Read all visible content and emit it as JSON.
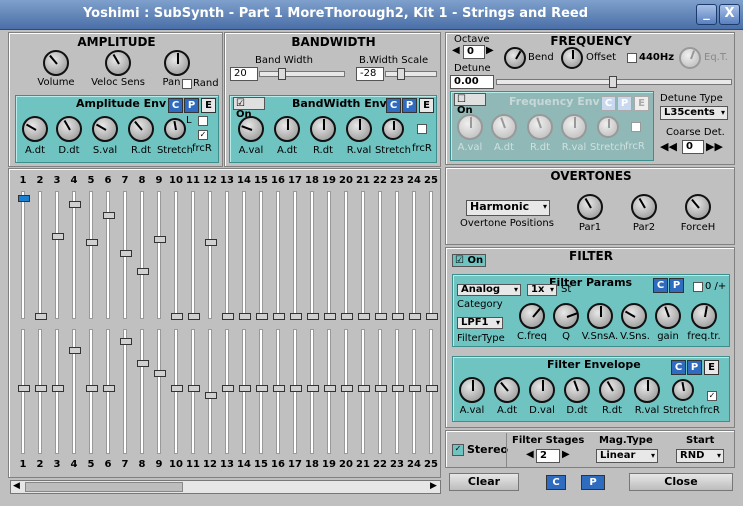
{
  "window": {
    "title": "Yoshimi : SubSynth - Part 1 MoreThorough2, Kit 1 - Strings and Reed",
    "minimize": "_",
    "close": "X"
  },
  "amplitude": {
    "title": "AMPLITUDE",
    "volume": "Volume",
    "velsens": "Veloc Sens",
    "pan": "Pan",
    "rand": "Rand",
    "env": {
      "title": "Amplitude Env",
      "c": "C",
      "p": "P",
      "e": "E",
      "l": "L",
      "knobs": [
        "A.dt",
        "D.dt",
        "S.val",
        "R.dt",
        "Stretch"
      ],
      "frcr": "frcR"
    }
  },
  "bandwidth": {
    "title": "BANDWIDTH",
    "bw": "Band Width",
    "bw_value": "20",
    "bwscale": "B.Width Scale",
    "bwscale_value": "-28",
    "env": {
      "on": "On",
      "title": "BandWidth Env",
      "c": "C",
      "p": "P",
      "e": "E",
      "knobs": [
        "A.val",
        "A.dt",
        "R.dt",
        "R.val",
        "Stretch"
      ],
      "frcr": "frcR"
    }
  },
  "frequency": {
    "title": "FREQUENCY",
    "octave": "Octave",
    "octave_value": "0",
    "bend": "Bend",
    "offset": "Offset",
    "hz440": "440Hz",
    "eqt": "Eq.T.",
    "detune": "Detune",
    "detune_value": "0.00",
    "detunetype": "Detune Type",
    "detunetype_value": "L35cents",
    "coarse": "Coarse Det.",
    "coarse_value": "0",
    "env": {
      "on": "On",
      "title": "Frequency Env",
      "c": "C",
      "p": "P",
      "e": "E",
      "knobs": [
        "A.val",
        "A.dt",
        "R.dt",
        "R.val",
        "Stretch"
      ],
      "frcr": "frcR"
    }
  },
  "harmonics": {
    "numbers": [
      "1",
      "2",
      "3",
      "4",
      "5",
      "6",
      "7",
      "8",
      "9",
      "10",
      "11",
      "12",
      "13",
      "14",
      "15",
      "16",
      "17",
      "18",
      "19",
      "20",
      "21",
      "22",
      "23",
      "24",
      "25"
    ],
    "magnitudes": [
      1.0,
      0,
      0.68,
      0.95,
      0.63,
      0.86,
      0.53,
      0.38,
      0.65,
      0,
      0,
      0.63,
      0,
      0,
      0,
      0,
      0,
      0,
      0,
      0,
      0,
      0,
      0,
      0,
      0
    ],
    "bandwidths": [
      0.5,
      0.5,
      0.5,
      0.84,
      0.5,
      0.5,
      0.92,
      0.72,
      0.63,
      0.5,
      0.5,
      0.44,
      0.5,
      0.5,
      0.5,
      0.5,
      0.5,
      0.5,
      0.5,
      0.5,
      0.5,
      0.5,
      0.5,
      0.5,
      0.5
    ]
  },
  "overtones": {
    "title": "OVERTONES",
    "positions_value": "Harmonic",
    "positions": "Overtone Positions",
    "knobs": [
      "Par1",
      "Par2",
      "ForceH"
    ]
  },
  "filter": {
    "title": "FILTER",
    "on": "On",
    "params": {
      "title": "Filter Params",
      "c": "C",
      "p": "P",
      "cat_value": "Analog",
      "st_value": "1x",
      "st": "St",
      "category": "Category",
      "type_value": "LPF1",
      "filtertype": "FilterType",
      "pol": "0 /+",
      "knobs": [
        "C.freq",
        "Q",
        "V.SnsA.",
        "V.Sns.",
        "gain",
        "freq.tr."
      ]
    },
    "env": {
      "title": "Filter Envelope",
      "c": "C",
      "p": "P",
      "e": "E",
      "knobs": [
        "A.val",
        "A.dt",
        "D.val",
        "D.dt",
        "R.dt",
        "R.val",
        "Stretch"
      ],
      "frcr": "frcR"
    }
  },
  "stereo": "Stereo",
  "stages": {
    "label": "Filter Stages",
    "value": "2"
  },
  "magtype": {
    "label": "Mag.Type",
    "value": "Linear"
  },
  "start": {
    "label": "Start",
    "value": "RND"
  },
  "footer": {
    "clear": "Clear",
    "c": "C",
    "p": "P",
    "close": "Close"
  }
}
